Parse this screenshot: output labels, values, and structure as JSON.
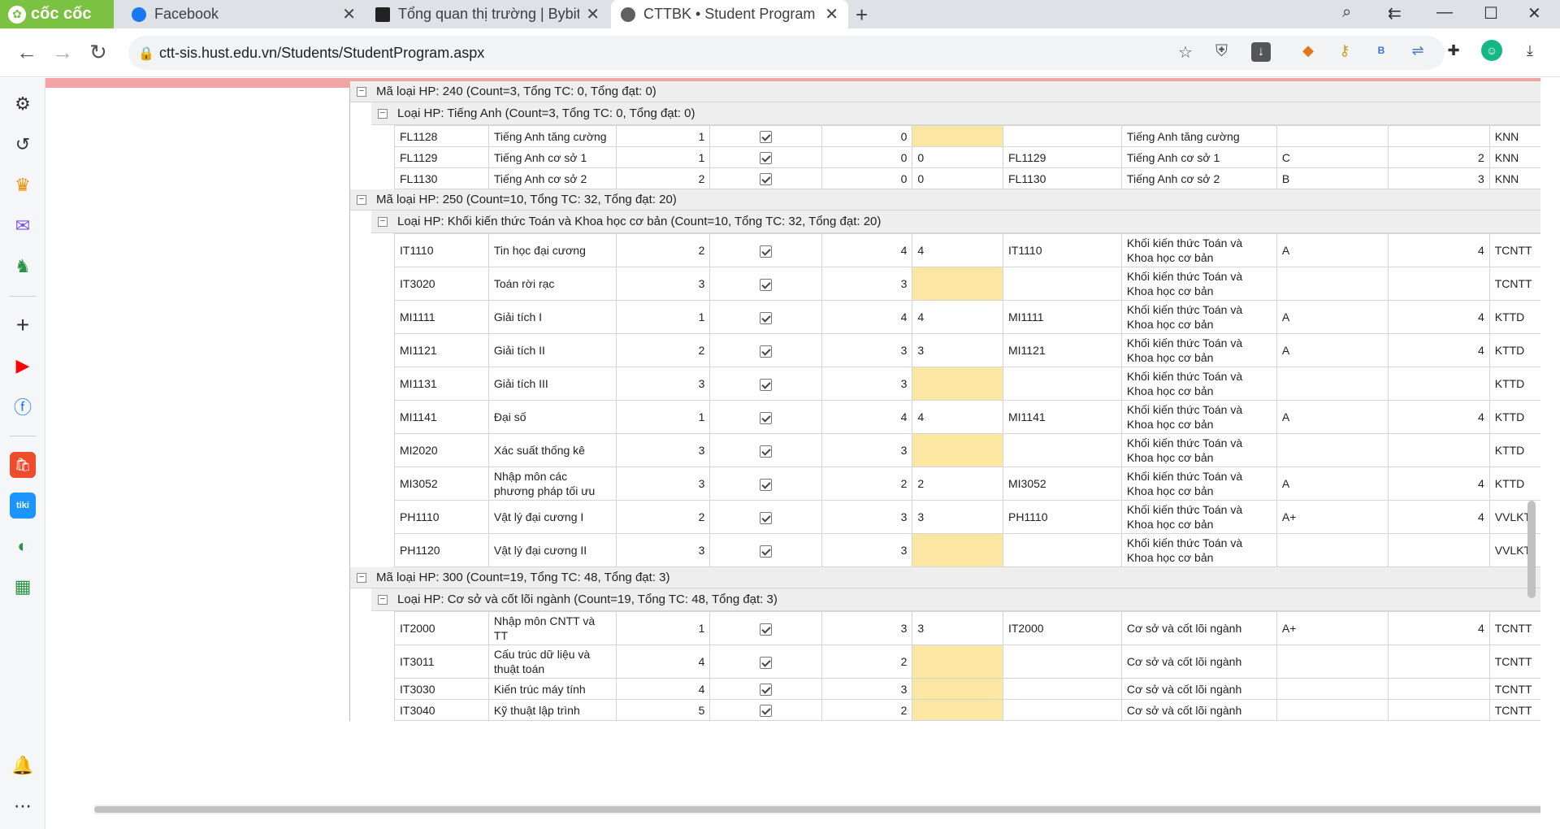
{
  "browser": {
    "brand": "cốc cốc",
    "tabs": [
      {
        "title": "Facebook",
        "fav_color": "#1877f2"
      },
      {
        "title": "Tổng quan thị trường | Bybit",
        "fav_color": "#222222"
      },
      {
        "title": "CTTBK • Student Program",
        "fav_color": "#606060"
      }
    ],
    "url": "ctt-sis.hust.edu.vn/Students/StudentProgram.aspx"
  },
  "program": {
    "groups": [
      {
        "header": "Mã loại HP: 240 (Count=3, Tổng TC: 0, Tổng đạt: 0)",
        "subgroups": [
          {
            "header": "Loại HP: Tiếng Anh (Count=3, Tổng TC: 0, Tổng đạt: 0)",
            "rows": [
              {
                "code": "FL1128",
                "name": "Tiếng Anh tăng cường",
                "sem": "1",
                "credits": "0",
                "earned": "",
                "code2": "",
                "type": "Tiếng Anh tăng cường",
                "grade": "",
                "score": "",
                "dept": "KNN"
              },
              {
                "code": "FL1129",
                "name": "Tiếng Anh cơ sở 1",
                "sem": "1",
                "credits": "0",
                "earned": "0",
                "code2": "FL1129",
                "type": "Tiếng Anh cơ sở 1",
                "grade": "C",
                "score": "2",
                "dept": "KNN"
              },
              {
                "code": "FL1130",
                "name": "Tiếng Anh cơ sở 2",
                "sem": "2",
                "credits": "0",
                "earned": "0",
                "code2": "FL1130",
                "type": "Tiếng Anh cơ sở 2",
                "grade": "B",
                "score": "3",
                "dept": "KNN"
              }
            ]
          }
        ]
      },
      {
        "header": "Mã loại HP: 250 (Count=10, Tổng TC: 32, Tổng đạt: 20)",
        "subgroups": [
          {
            "header": "Loại HP: Khối kiến thức Toán và Khoa học cơ bản (Count=10, Tổng TC: 32, Tổng đạt: 20)",
            "rows": [
              {
                "code": "IT1110",
                "name": "Tin học đại cương",
                "sem": "2",
                "credits": "4",
                "earned": "4",
                "code2": "IT1110",
                "type": "Khối kiến thức Toán và Khoa học cơ bản",
                "grade": "A",
                "score": "4",
                "dept": "TCNTT"
              },
              {
                "code": "IT3020",
                "name": "Toán rời rạc",
                "sem": "3",
                "credits": "3",
                "earned": "",
                "code2": "",
                "type": "Khối kiến thức Toán và Khoa học cơ bản",
                "grade": "",
                "score": "",
                "dept": "TCNTT"
              },
              {
                "code": "MI1111",
                "name": "Giải tích I",
                "sem": "1",
                "credits": "4",
                "earned": "4",
                "code2": "MI1111",
                "type": "Khối kiến thức Toán và Khoa học cơ bản",
                "grade": "A",
                "score": "4",
                "dept": "KTTD"
              },
              {
                "code": "MI1121",
                "name": "Giải tích II",
                "sem": "2",
                "credits": "3",
                "earned": "3",
                "code2": "MI1121",
                "type": "Khối kiến thức Toán và Khoa học cơ bản",
                "grade": "A",
                "score": "4",
                "dept": "KTTD"
              },
              {
                "code": "MI1131",
                "name": "Giải tích III",
                "sem": "3",
                "credits": "3",
                "earned": "",
                "code2": "",
                "type": "Khối kiến thức Toán và Khoa học cơ bản",
                "grade": "",
                "score": "",
                "dept": "KTTD"
              },
              {
                "code": "MI1141",
                "name": "Đại số",
                "sem": "1",
                "credits": "4",
                "earned": "4",
                "code2": "MI1141",
                "type": "Khối kiến thức Toán và Khoa học cơ bản",
                "grade": "A",
                "score": "4",
                "dept": "KTTD"
              },
              {
                "code": "MI2020",
                "name": "Xác suất thống kê",
                "sem": "3",
                "credits": "3",
                "earned": "",
                "code2": "",
                "type": "Khối kiến thức Toán và Khoa học cơ bản",
                "grade": "",
                "score": "",
                "dept": "KTTD"
              },
              {
                "code": "MI3052",
                "name": "Nhập môn các phương pháp tối ưu",
                "sem": "3",
                "credits": "2",
                "earned": "2",
                "code2": "MI3052",
                "type": "Khối kiến thức Toán và Khoa học cơ bản",
                "grade": "A",
                "score": "4",
                "dept": "KTTD"
              },
              {
                "code": "PH1110",
                "name": "Vật lý đại cương I",
                "sem": "2",
                "credits": "3",
                "earned": "3",
                "code2": "PH1110",
                "type": "Khối kiến thức Toán và Khoa học cơ bản",
                "grade": "A+",
                "score": "4",
                "dept": "VVLKT"
              },
              {
                "code": "PH1120",
                "name": "Vật lý đại cương II",
                "sem": "3",
                "credits": "3",
                "earned": "",
                "code2": "",
                "type": "Khối kiến thức Toán và Khoa học cơ bản",
                "grade": "",
                "score": "",
                "dept": "VVLKT"
              }
            ]
          }
        ]
      },
      {
        "header": "Mã loại HP: 300 (Count=19, Tổng TC: 48, Tổng đạt: 3)",
        "subgroups": [
          {
            "header": "Loại HP: Cơ sở và cốt lõi ngành (Count=19, Tổng TC: 48, Tổng đạt: 3)",
            "rows": [
              {
                "code": "IT2000",
                "name": "Nhập môn CNTT và TT",
                "sem": "1",
                "credits": "3",
                "earned": "3",
                "code2": "IT2000",
                "type": "Cơ sở và cốt lõi ngành",
                "grade": "A+",
                "score": "4",
                "dept": "TCNTT"
              },
              {
                "code": "IT3011",
                "name": "Cấu trúc dữ liệu và thuật toán",
                "sem": "4",
                "credits": "2",
                "earned": "",
                "code2": "",
                "type": "Cơ sở và cốt lõi ngành",
                "grade": "",
                "score": "",
                "dept": "TCNTT"
              },
              {
                "code": "IT3030",
                "name": "Kiến trúc máy tính",
                "sem": "4",
                "credits": "3",
                "earned": "",
                "code2": "",
                "type": "Cơ sở và cốt lõi ngành",
                "grade": "",
                "score": "",
                "dept": "TCNTT"
              },
              {
                "code": "IT3040",
                "name": "Kỹ thuật lập trình",
                "sem": "5",
                "credits": "2",
                "earned": "",
                "code2": "",
                "type": "Cơ sở và cốt lõi ngành",
                "grade": "",
                "score": "",
                "dept": "TCNTT"
              }
            ]
          }
        ]
      }
    ]
  }
}
